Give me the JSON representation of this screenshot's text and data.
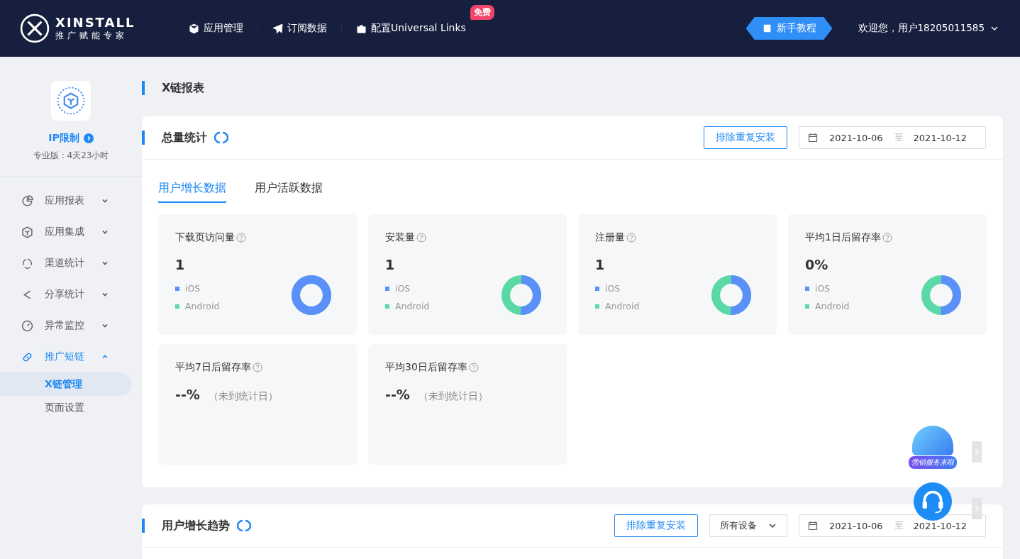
{
  "header": {
    "logo_name": "XINSTALL",
    "logo_tagline": "推广赋能专家",
    "nav": [
      {
        "label": "应用管理"
      },
      {
        "label": "订阅数据"
      },
      {
        "label": "配置Universal Links",
        "badge": "免费"
      }
    ],
    "tutorial_button": "新手教程",
    "user": "欢迎您，用户18205011585"
  },
  "sidebar": {
    "plan_label": "IP限制",
    "plan_detail": "专业版：4天23小时",
    "items": [
      {
        "label": "应用报表",
        "expanded": false
      },
      {
        "label": "应用集成",
        "expanded": false
      },
      {
        "label": "渠道统计",
        "expanded": false
      },
      {
        "label": "分享统计",
        "expanded": false
      },
      {
        "label": "异常监控",
        "expanded": false
      },
      {
        "label": "推广短链",
        "expanded": true,
        "children": [
          {
            "label": "X链管理",
            "selected": true
          },
          {
            "label": "页面设置",
            "selected": false
          }
        ]
      }
    ]
  },
  "page_title": "X链报表",
  "summary": {
    "title": "总量统计",
    "dedupe_button": "排除重复安装",
    "date_from": "2021-10-06",
    "date_sep": "至",
    "date_to": "2021-10-12",
    "tabs": [
      {
        "label": "用户增长数据",
        "selected": true
      },
      {
        "label": "用户活跃数据",
        "selected": false
      }
    ],
    "stats": [
      {
        "label": "下载页访问量",
        "value": "1",
        "level": 1,
        "legend": [
          {
            "label": "iOS",
            "color": "#5b8ff9"
          },
          {
            "label": "Android",
            "color": "#5ad8a6"
          }
        ]
      },
      {
        "label": "安装量",
        "value": "1",
        "level": 0.5,
        "legend": [
          {
            "label": "iOS",
            "color": "#5b8ff9"
          },
          {
            "label": "Android",
            "color": "#5ad8a6"
          }
        ]
      },
      {
        "label": "注册量",
        "value": "1",
        "level": 0.5,
        "legend": [
          {
            "label": "iOS",
            "color": "#5b8ff9"
          },
          {
            "label": "Android",
            "color": "#5ad8a6"
          }
        ]
      },
      {
        "label": "平均1日后留存率",
        "value": "0%",
        "level": 0.5,
        "legend": [
          {
            "label": "iOS",
            "color": "#5b8ff9"
          },
          {
            "label": "Android",
            "color": "#5ad8a6"
          }
        ]
      },
      {
        "label": "平均7日后留存率",
        "value": "--%",
        "note": "（未到统计日）"
      },
      {
        "label": "平均30日后留存率",
        "value": "--%",
        "note": "（未到统计日）"
      }
    ]
  },
  "trend": {
    "title": "用户增长趋势",
    "dedupe_button": "排除重复安装",
    "device_select": "所有设备",
    "date_from": "2021-10-06",
    "date_sep": "至",
    "date_to": "2021-10-12"
  },
  "promo_label": "营销服务来啦"
}
